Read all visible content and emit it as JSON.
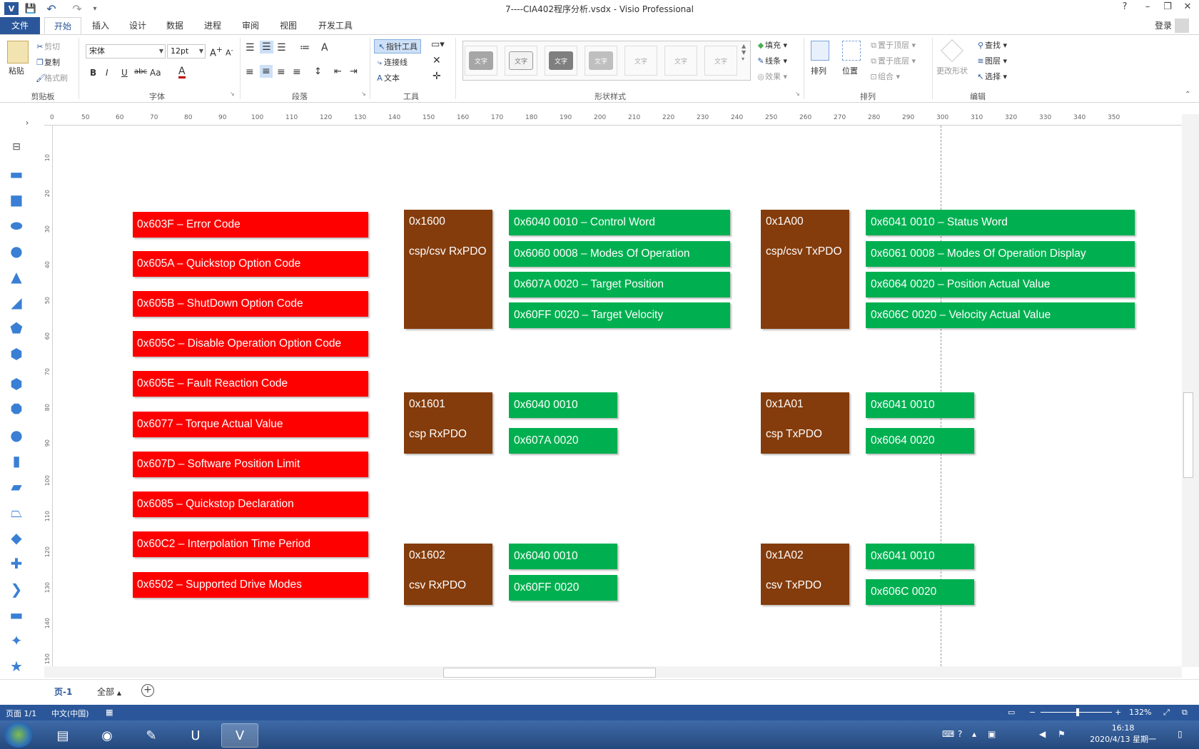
{
  "window": {
    "title": "7----CIA402程序分析.vsdx - Visio Professional",
    "help": "?",
    "minimize": "–",
    "restore": "❐",
    "close": "✕"
  },
  "quick_access": {
    "undo": "↶",
    "redo": "↷",
    "save": "💾",
    "customize": "▾"
  },
  "tabs": [
    "文件",
    "开始",
    "插入",
    "设计",
    "数据",
    "进程",
    "审阅",
    "视图",
    "开发工具"
  ],
  "account": {
    "signin": "登录"
  },
  "ribbon": {
    "clipboard": {
      "label": "剪贴板",
      "paste": "粘贴",
      "cut": "剪切",
      "copy": "复制",
      "format_painter": "格式刷"
    },
    "font": {
      "label": "字体",
      "name": "宋体",
      "size": "12pt",
      "bold": "B",
      "italic": "I",
      "underline": "U",
      "strike": "abc",
      "case": "Aa",
      "color": "A"
    },
    "paragraph": {
      "label": "段落"
    },
    "tools": {
      "label": "工具",
      "pointer": "指针工具",
      "connector": "连接线",
      "text": "文本"
    },
    "shape_styles": {
      "label": "形状样式",
      "sample": "文字",
      "fill": "填充",
      "line": "线条",
      "effects": "效果"
    },
    "arrange": {
      "label": "排列",
      "align": "排列",
      "position": "位置",
      "bring_front": "置于顶层",
      "send_back": "置于底层",
      "group": "组合"
    },
    "editing": {
      "label": "编辑",
      "change_shape": "更改形状",
      "find": "查找",
      "layers": "图层",
      "select": "选择"
    }
  },
  "rulers": {
    "h": [
      "0",
      "50",
      "60",
      "70",
      "80",
      "90",
      "100",
      "110",
      "120",
      "130",
      "140",
      "150",
      "160",
      "170",
      "180",
      "190",
      "200",
      "210",
      "220",
      "230",
      "240",
      "250",
      "260",
      "270",
      "280",
      "290",
      "300",
      "310",
      "320",
      "330",
      "340",
      "350"
    ],
    "v": [
      "10",
      "20",
      "30",
      "40",
      "50",
      "60",
      "70",
      "80",
      "90",
      "100",
      "110",
      "120",
      "130",
      "140",
      "150"
    ]
  },
  "diagram": {
    "red_objects": [
      "0x603F  –  Error Code",
      "0x605A  –  Quickstop Option Code",
      "0x605B  –  ShutDown Option Code",
      "0x605C  –  Disable Operation Option Code",
      "0x605E  –  Fault Reaction Code",
      "0x6077  –  Torque Actual Value",
      "0x607D  –  Software Position Limit",
      "0x6085  –  Quickstop Declaration",
      "0x60C2  –  Interpolation Time Period",
      "0x6502  –  Supported Drive Modes"
    ],
    "rx_1600": {
      "index": "0x1600",
      "name": "csp/csv RxPDO",
      "items": [
        "0x6040 0010  –  Control Word",
        "0x6060 0008  –  Modes Of Operation",
        "0x607A 0020  –  Target Position",
        "0x60FF 0020  –  Target Velocity"
      ]
    },
    "tx_1a00": {
      "index": "0x1A00",
      "name": "csp/csv TxPDO",
      "items": [
        "0x6041 0010  –  Status Word",
        "0x6061 0008  –  Modes Of Operation Display",
        "0x6064 0020  –  Position Actual Value",
        "0x606C 0020  –  Velocity Actual Value"
      ]
    },
    "rx_1601": {
      "index": "0x1601",
      "name": "csp RxPDO",
      "items": [
        "0x6040 0010",
        "0x607A 0020"
      ]
    },
    "tx_1a01": {
      "index": "0x1A01",
      "name": "csp TxPDO",
      "items": [
        "0x6041 0010",
        "0x6064 0020"
      ]
    },
    "rx_1602": {
      "index": "0x1602",
      "name": "csv RxPDO",
      "items": [
        "0x6040 0010",
        "0x60FF 0020"
      ]
    },
    "tx_1a02": {
      "index": "0x1A02",
      "name": "csv TxPDO",
      "items": [
        "0x6041 0010",
        "0x606C 0020"
      ]
    },
    "colors": {
      "red": "#ff0000",
      "green": "#00b050",
      "brown": "#843c0c"
    }
  },
  "pages": {
    "current": "页-1",
    "all": "全部",
    "add": "+"
  },
  "status": {
    "page": "页面 1/1",
    "language": "中文(中国)",
    "zoom": "132%"
  },
  "taskbar": {
    "time": "16:18",
    "date": "2020/4/13 星期一"
  }
}
